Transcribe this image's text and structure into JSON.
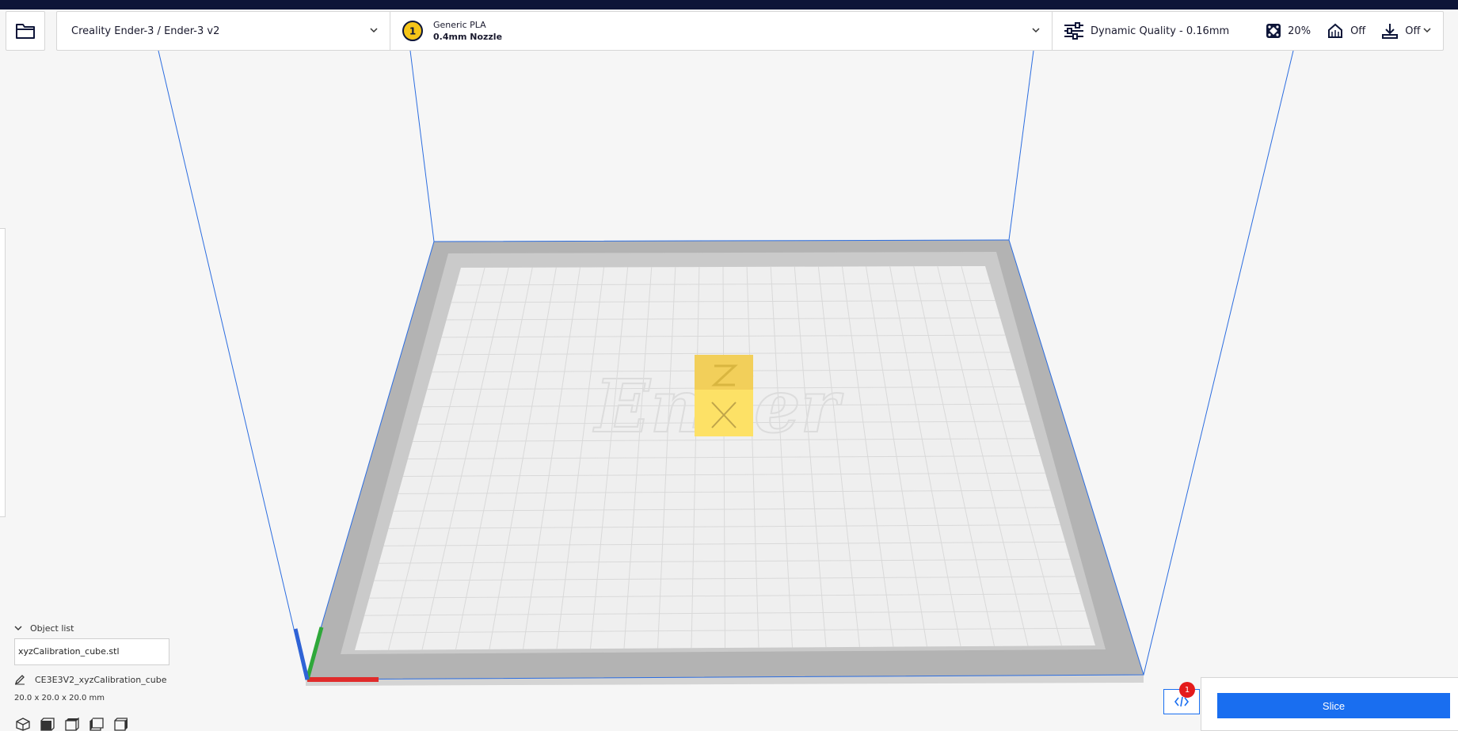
{
  "printer": {
    "name": "Creality Ender-3 / Ender-3 v2"
  },
  "material": {
    "extruder_number": "1",
    "name": "Generic PLA",
    "nozzle": "0.4mm Nozzle"
  },
  "settings": {
    "profile": "Dynamic Quality - 0.16mm",
    "infill": "20%",
    "support": "Off",
    "adhesion": "Off"
  },
  "object_list": {
    "header": "Object list",
    "file": "xyzCalibration_cube.stl",
    "object_name": "CE3E3V2_xyzCalibration_cube",
    "dimensions": "20.0 x 20.0 x 20.0 mm"
  },
  "viewport": {
    "cube_colors": {
      "top": "#f2cf5a",
      "front": "#fde166"
    },
    "axis_colors": {
      "x": "#e02b2b",
      "y": "#2fa83a",
      "z": "#2f63d6"
    },
    "bed_watermark": "Ender"
  },
  "messages": {
    "count": "1"
  },
  "slice": {
    "label": "Slice"
  }
}
